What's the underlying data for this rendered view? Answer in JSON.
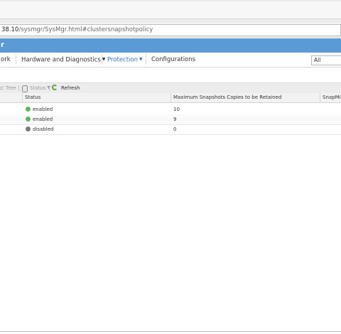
{
  "browser": {
    "url_host": "38.10",
    "url_path": "/sysmgr/SysMgr.html#clustersnapshotpolicy"
  },
  "banner": {
    "text": "r"
  },
  "menu": {
    "items": [
      {
        "label": "ork",
        "has_caret": false,
        "active": false
      },
      {
        "label": "Hardware and Diagnostics",
        "has_caret": true,
        "active": false
      },
      {
        "label": "Protection",
        "has_caret": true,
        "active": true
      },
      {
        "label": "Configurations",
        "has_caret": false,
        "active": false
      }
    ],
    "search_scope": "All"
  },
  "toolbar": {
    "tree_label": "Tree",
    "status_label": "Status",
    "refresh_label": "Refresh"
  },
  "grid": {
    "columns": [
      "Status",
      "Maximum Snapshots Copies to be Retained",
      "SnapMir"
    ],
    "rows": [
      {
        "status": "enabled",
        "status_color": "#5cb85c",
        "max_copies": "10"
      },
      {
        "status": "enabled",
        "status_color": "#5cb85c",
        "max_copies": "9"
      },
      {
        "status": "disabled",
        "status_color": "#7a7a7a",
        "max_copies": "0"
      }
    ]
  },
  "colors": {
    "banner": "#5b9bd5",
    "active_menu": "#2e75b6",
    "enabled": "#5cb85c",
    "disabled": "#7a7a7a"
  }
}
